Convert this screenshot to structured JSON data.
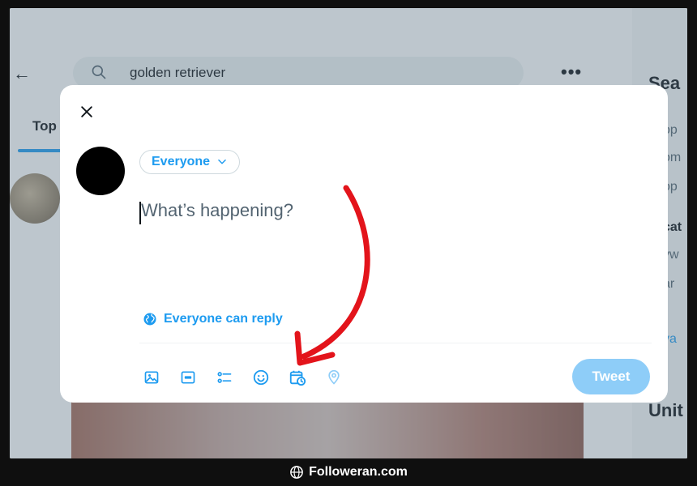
{
  "background": {
    "search": {
      "value": "golden retriever"
    },
    "tabs": {
      "active_label": "Top"
    },
    "right_panel": {
      "title": "Sea",
      "snippets": [
        "op",
        "om",
        "op",
        "cat",
        "yw",
        "ar",
        "va"
      ],
      "bottom_title": "Unit"
    }
  },
  "modal": {
    "audience_label": "Everyone",
    "composer_placeholder": "What’s happening?",
    "reply_setting_label": "Everyone can reply",
    "tweet_button_label": "Tweet",
    "toolbar_icons": [
      "media-icon",
      "gif-icon",
      "poll-icon",
      "emoji-icon",
      "schedule-icon",
      "location-icon"
    ]
  },
  "colors": {
    "accent": "#1d9bf0",
    "accent_disabled": "#8ecdf8",
    "annotation_arrow": "#e3141b"
  },
  "watermark": {
    "text": "Followeran.com"
  }
}
